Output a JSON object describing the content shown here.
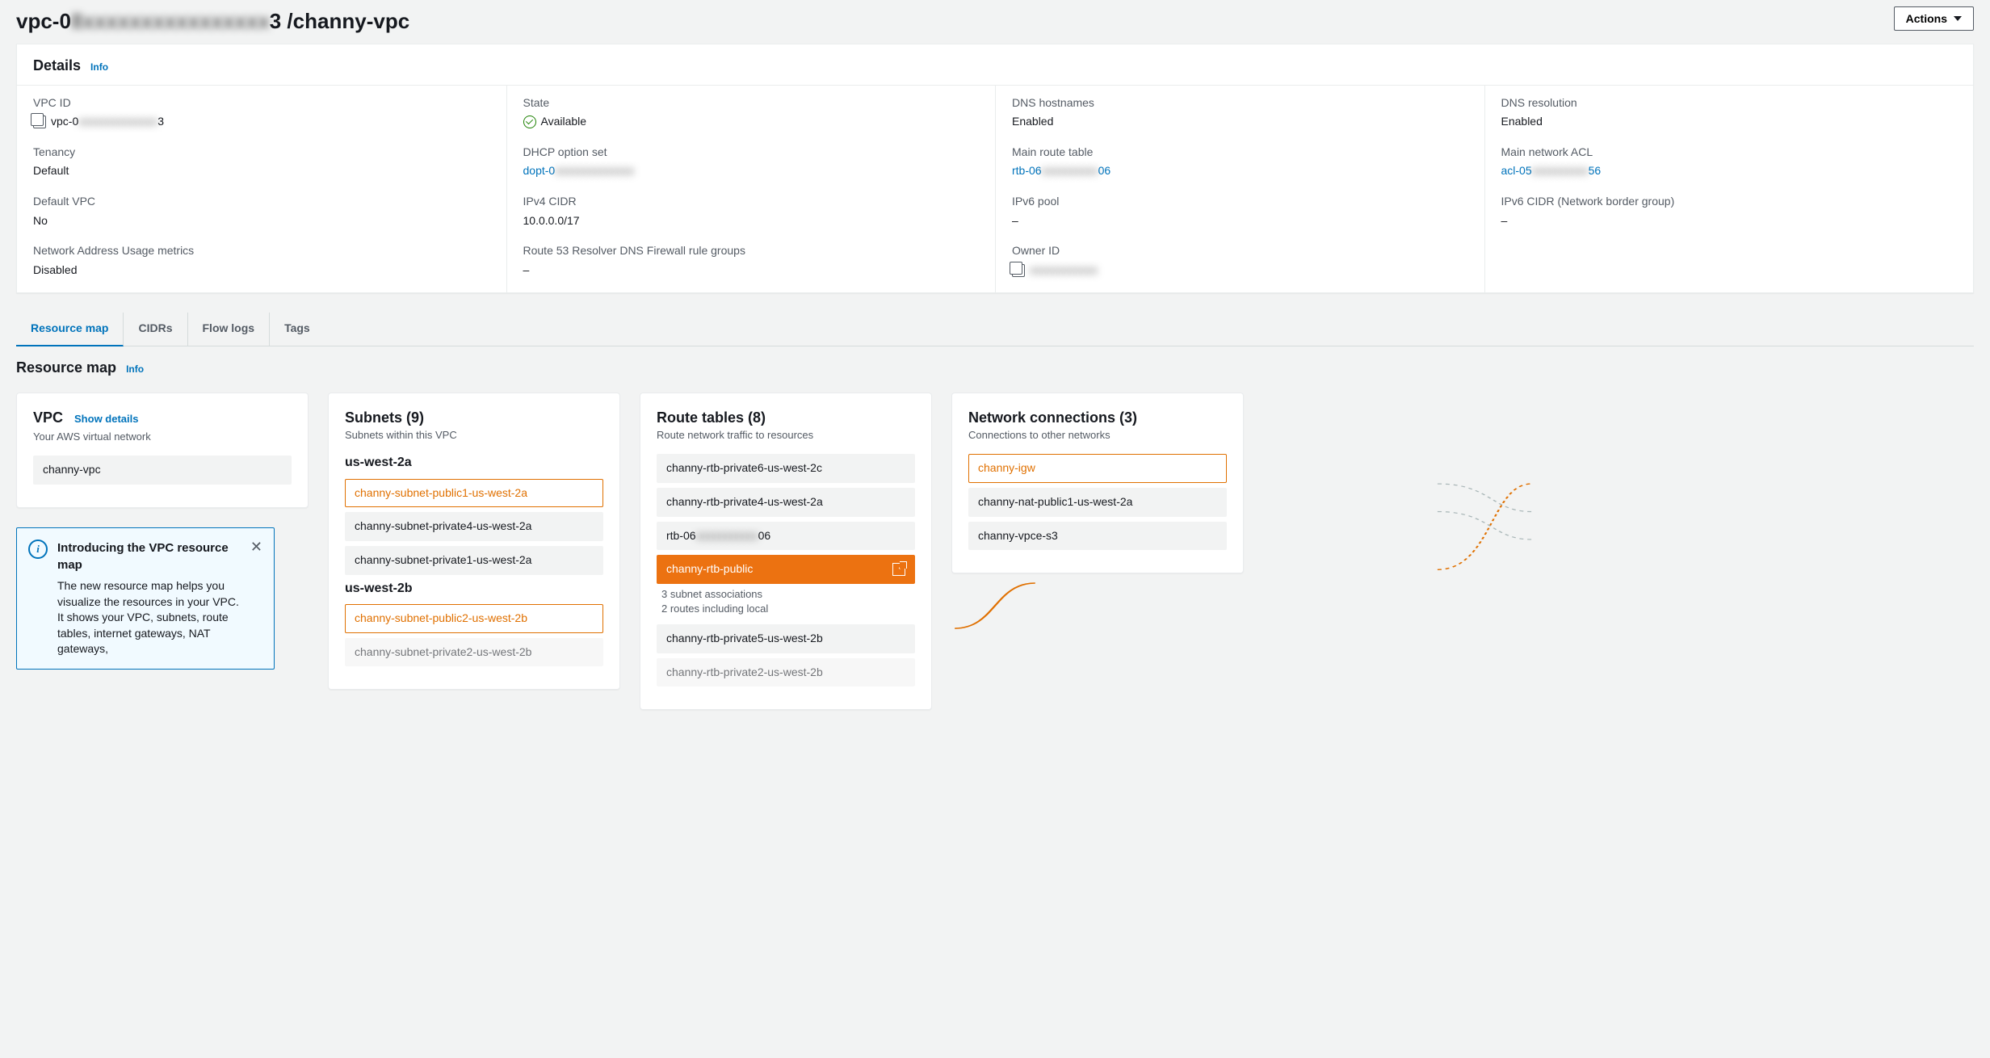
{
  "header": {
    "title_prefix": "vpc-0",
    "title_obscured1": "8xxxxxxxxxxxxxxxx",
    "title_mid": "3 / ",
    "title_name": "channy-vpc",
    "actions_label": "Actions"
  },
  "details_panel": {
    "title": "Details",
    "info_label": "Info",
    "rows": {
      "vpc_id_label": "VPC ID",
      "vpc_id_prefix": "vpc-0",
      "vpc_id_obscured": "xxxxxxxxxxxxxx",
      "vpc_id_suffix": "3",
      "state_label": "State",
      "state_value": "Available",
      "dns_hostnames_label": "DNS hostnames",
      "dns_hostnames_value": "Enabled",
      "dns_resolution_label": "DNS resolution",
      "dns_resolution_value": "Enabled",
      "tenancy_label": "Tenancy",
      "tenancy_value": "Default",
      "dhcp_label": "DHCP option set",
      "dhcp_prefix": "dopt-0",
      "dhcp_obscured": "xxxxxxxxxxxxxx",
      "main_rt_label": "Main route table",
      "main_rt_prefix": "rtb-06",
      "main_rt_obscured": "xxxxxxxxxx",
      "main_rt_suffix": "06",
      "main_acl_label": "Main network ACL",
      "main_acl_prefix": "acl-05",
      "main_acl_obscured": "xxxxxxxxxx",
      "main_acl_suffix": "56",
      "default_vpc_label": "Default VPC",
      "default_vpc_value": "No",
      "ipv4_cidr_label": "IPv4 CIDR",
      "ipv4_cidr_value": "10.0.0.0/17",
      "ipv6_pool_label": "IPv6 pool",
      "ipv6_pool_value": "–",
      "ipv6_cidr_label": "IPv6 CIDR (Network border group)",
      "ipv6_cidr_value": "–",
      "nau_label": "Network Address Usage metrics",
      "nau_value": "Disabled",
      "r53_label": "Route 53 Resolver DNS Firewall rule groups",
      "r53_value": "–",
      "owner_label": "Owner ID",
      "owner_obscured": "xxxxxxxxxxxx"
    }
  },
  "tabs": {
    "resource_map": "Resource map",
    "cidrs": "CIDRs",
    "flow_logs": "Flow logs",
    "tags": "Tags"
  },
  "resource_map": {
    "title": "Resource map",
    "info_label": "Info",
    "vpc_card": {
      "title": "VPC",
      "show_details": "Show details",
      "subtitle": "Your AWS virtual network",
      "name": "channy-vpc"
    },
    "subnets_card": {
      "title": "Subnets (9)",
      "subtitle": "Subnets within this VPC",
      "az1": "us-west-2a",
      "az1_items": [
        "channy-subnet-public1-us-west-2a",
        "channy-subnet-private4-us-west-2a",
        "channy-subnet-private1-us-west-2a"
      ],
      "az2": "us-west-2b",
      "az2_items": [
        "channy-subnet-public2-us-west-2b",
        "channy-subnet-private2-us-west-2b"
      ]
    },
    "routes_card": {
      "title": "Route tables (8)",
      "subtitle": "Route network traffic to resources",
      "items_top": [
        "channy-rtb-private6-us-west-2c",
        "channy-rtb-private4-us-west-2a"
      ],
      "rtb_obscured_prefix": "rtb-06",
      "rtb_obscured_blur": "xxxxxxxxxxx",
      "rtb_obscured_suffix": "06",
      "selected": "channy-rtb-public",
      "selected_meta1": "3 subnet associations",
      "selected_meta2": "2 routes including local",
      "items_bottom": [
        "channy-rtb-private5-us-west-2b",
        "channy-rtb-private2-us-west-2b"
      ]
    },
    "conn_card": {
      "title": "Network connections (3)",
      "subtitle": "Connections to other networks",
      "selected": "channy-igw",
      "items": [
        "channy-nat-public1-us-west-2a",
        "channy-vpce-s3"
      ]
    }
  },
  "info_box": {
    "title": "Introducing the VPC resource map",
    "body": "The new resource map helps you visualize the resources in your VPC. It shows your VPC, subnets, route tables, internet gateways, NAT gateways,"
  }
}
